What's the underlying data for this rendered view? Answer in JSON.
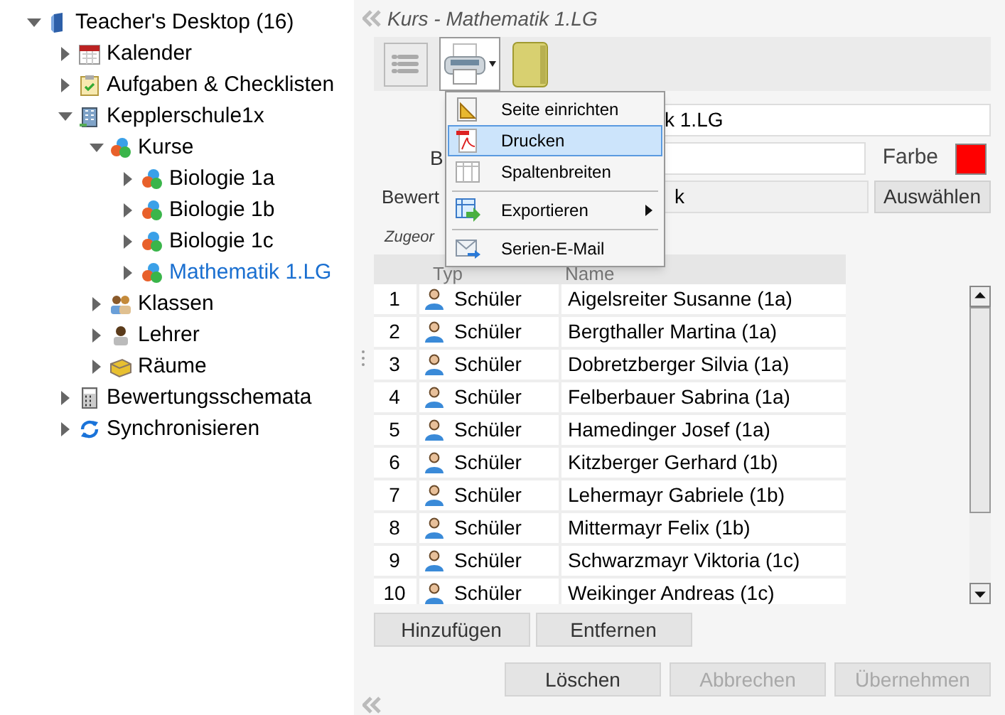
{
  "tree": [
    {
      "label": "Teacher's Desktop (16)",
      "kind": "book",
      "expanded": true,
      "selected": false,
      "children": [
        {
          "label": "Kalender",
          "kind": "calendar",
          "expanded": false,
          "selected": false
        },
        {
          "label": "Aufgaben & Checklisten",
          "kind": "clipboard",
          "expanded": false,
          "selected": false
        },
        {
          "label": "Kepplerschule1x",
          "kind": "building",
          "expanded": true,
          "selected": false,
          "children": [
            {
              "label": "Kurse",
              "kind": "course",
              "expanded": true,
              "selected": false,
              "children": [
                {
                  "label": "Biologie 1a",
                  "kind": "course",
                  "expanded": false,
                  "selected": false
                },
                {
                  "label": "Biologie 1b",
                  "kind": "course",
                  "expanded": false,
                  "selected": false
                },
                {
                  "label": "Biologie 1c",
                  "kind": "course",
                  "expanded": false,
                  "selected": false
                },
                {
                  "label": "Mathematik 1.LG",
                  "kind": "course",
                  "expanded": false,
                  "selected": true
                }
              ]
            },
            {
              "label": "Klassen",
              "kind": "people",
              "expanded": false,
              "selected": false
            },
            {
              "label": "Lehrer",
              "kind": "person",
              "expanded": false,
              "selected": false
            },
            {
              "label": "Räume",
              "kind": "room",
              "expanded": false,
              "selected": false
            }
          ]
        },
        {
          "label": "Bewertungsschemata",
          "kind": "calculator",
          "expanded": false,
          "selected": false
        },
        {
          "label": "Synchronisieren",
          "kind": "sync",
          "expanded": false,
          "selected": false
        }
      ]
    }
  ],
  "panel": {
    "title": "Kurs - Mathematik 1.LG",
    "form": {
      "name_value": "k 1.LG",
      "label_2": "B",
      "farbe_label": "Farbe",
      "color": "#ff0000",
      "label_3": "Bewert",
      "bewertung_value": "k",
      "select_button": "Auswählen",
      "section_label": "Zugeor"
    },
    "menu": [
      {
        "kind": "setup",
        "label": "Seite einrichten",
        "selected": false,
        "submenu": false
      },
      {
        "kind": "pdf",
        "label": "Drucken",
        "selected": true,
        "submenu": false
      },
      {
        "kind": "columns",
        "label": "Spaltenbreiten",
        "selected": false,
        "submenu": false
      },
      {
        "kind": "separator"
      },
      {
        "kind": "export",
        "label": "Exportieren",
        "selected": false,
        "submenu": true
      },
      {
        "kind": "separator"
      },
      {
        "kind": "mail",
        "label": "Serien-E-Mail",
        "selected": false,
        "submenu": false
      }
    ],
    "table": {
      "columns": [
        "Typ",
        "Name"
      ],
      "rows": [
        {
          "number": "1",
          "type": "Schüler",
          "name": "Aigelsreiter Susanne (1a)"
        },
        {
          "number": "2",
          "type": "Schüler",
          "name": "Bergthaller Martina (1a)"
        },
        {
          "number": "3",
          "type": "Schüler",
          "name": "Dobretzberger Silvia (1a)"
        },
        {
          "number": "4",
          "type": "Schüler",
          "name": "Felberbauer Sabrina (1a)"
        },
        {
          "number": "5",
          "type": "Schüler",
          "name": "Hamedinger Josef (1a)"
        },
        {
          "number": "6",
          "type": "Schüler",
          "name": "Kitzberger Gerhard (1b)"
        },
        {
          "number": "7",
          "type": "Schüler",
          "name": "Lehermayr Gabriele (1b)"
        },
        {
          "number": "8",
          "type": "Schüler",
          "name": "Mittermayr Felix (1b)"
        },
        {
          "number": "9",
          "type": "Schüler",
          "name": "Schwarzmayr Viktoria (1c)"
        },
        {
          "number": "10",
          "type": "Schüler",
          "name": "Weikinger Andreas (1c)"
        }
      ]
    },
    "table_buttons": [
      {
        "label": "Hinzufügen",
        "disabled": false
      },
      {
        "label": "Entfernen",
        "disabled": false
      }
    ],
    "footer_buttons": [
      {
        "label": "Löschen",
        "disabled": false
      },
      {
        "label": "Abbrechen",
        "disabled": true
      },
      {
        "label": "Übernehmen",
        "disabled": true
      }
    ]
  }
}
